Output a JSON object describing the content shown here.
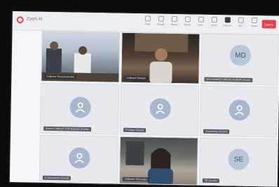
{
  "app": {
    "title": "Zoom AI"
  },
  "toolbar": {
    "buttons": [
      {
        "label": "Chat",
        "icon": "chat-icon"
      },
      {
        "label": "People",
        "icon": "people-icon"
      },
      {
        "label": "Raise",
        "icon": "hand-icon"
      },
      {
        "label": "React",
        "icon": "react-icon"
      },
      {
        "label": "View",
        "icon": "view-icon"
      },
      {
        "label": "More",
        "icon": "more-icon"
      },
      {
        "label": "Camera",
        "icon": "camera-icon"
      },
      {
        "label": "Mic",
        "icon": "mic-icon"
      },
      {
        "label": "Share",
        "icon": "share-icon"
      }
    ],
    "leave_label": "Leave"
  },
  "tiles": [
    {
      "name": "Collector Tiruvannamalai",
      "kind": "video"
    },
    {
      "name": "Collector Ranipet",
      "kind": "video"
    },
    {
      "name": "MOHAMMED DINESH KUMAR (Guest)",
      "kind": "initials",
      "initials": "MD"
    },
    {
      "name": "District Collector TVM Madurai (Guest)",
      "kind": "icon"
    },
    {
      "name": "R.Vijaya (Guest)",
      "kind": "icon"
    },
    {
      "name": "Jeyaseelan (Guest)",
      "kind": "icon"
    },
    {
      "name": "G.Saravanan (Guest)",
      "kind": "icon"
    },
    {
      "name": "Collector Thiruvallur",
      "kind": "video"
    },
    {
      "name": "SE (Guest)",
      "kind": "initials",
      "initials": "SE"
    }
  ]
}
